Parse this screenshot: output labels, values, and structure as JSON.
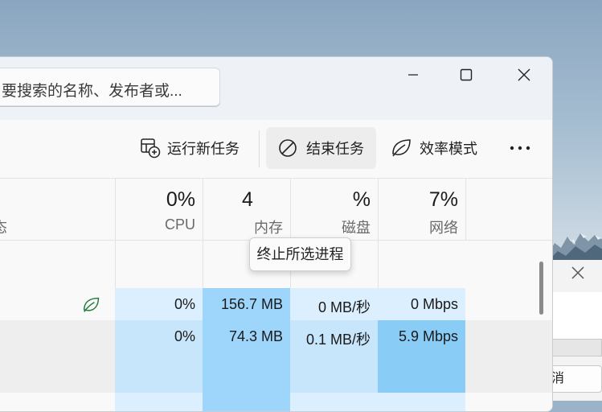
{
  "search": {
    "placeholder": "要搜索的名称、发布者或..."
  },
  "toolbar": {
    "run_new_task": "运行新任务",
    "end_task": "结束任务",
    "efficiency_mode": "效率模式",
    "more_icon": "more-horizontal-icon"
  },
  "tooltip": {
    "text": "终止所选进程"
  },
  "columns": {
    "status_label": "态",
    "cpu": {
      "percent": "0%",
      "name": "CPU"
    },
    "memory": {
      "percent": "4",
      "name": "内存"
    },
    "disk": {
      "percent": "%",
      "name": "磁盘"
    },
    "network": {
      "percent": "7%",
      "name": "网络"
    }
  },
  "rows": [
    {
      "cpu": "0%",
      "memory": "156.7 MB",
      "disk": "0 MB/秒",
      "network": "0 Mbps",
      "efficiency": true
    },
    {
      "cpu": "0%",
      "memory": "74.3 MB",
      "disk": "0.1 MB/秒",
      "network": "5.9 Mbps",
      "efficiency": false
    }
  ],
  "bg_dialog": {
    "cancel_label": "取消"
  },
  "colors": {
    "heat_light": "#dcefff",
    "heat_medium": "#c7e5fb",
    "heat_strong": "#9dd5fb",
    "heat_strongest": "#89cdf7",
    "leaf_green": "#1e7a3a"
  }
}
